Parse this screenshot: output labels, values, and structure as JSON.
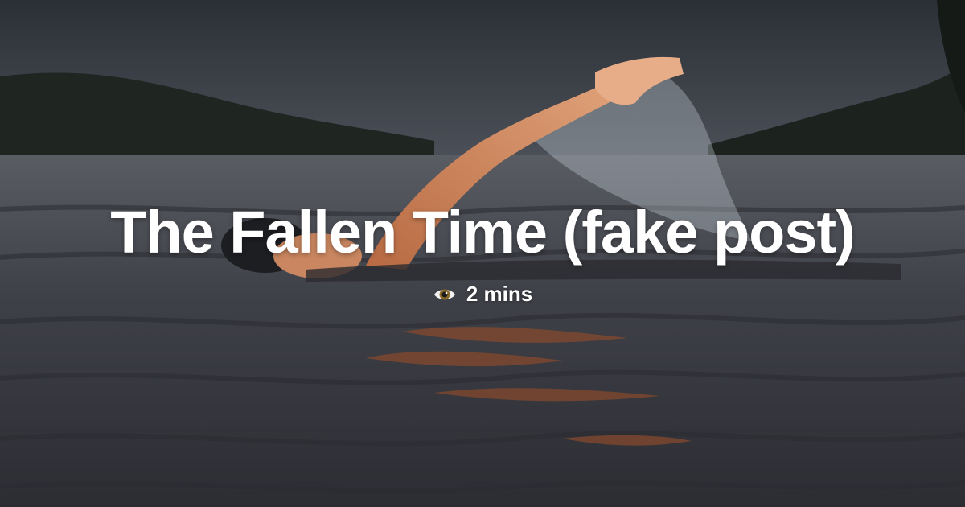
{
  "post": {
    "title": "The Fallen Time (fake post)",
    "reading_time": "2 mins",
    "reading_time_icon": "eye-icon"
  },
  "colors": {
    "title_text": "#ffffff",
    "sky": "#3b3f47",
    "water": "#3a3c44"
  }
}
